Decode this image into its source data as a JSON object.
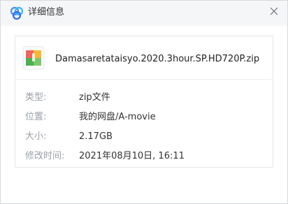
{
  "window": {
    "title": "详细信息",
    "app_logo_icon": "cloud-logo-icon",
    "close_icon": "close-icon"
  },
  "file": {
    "name": "Damasaretataisyo.2020.3hour.SP.HD720P.zip",
    "icon": "zip-file-icon"
  },
  "details": [
    {
      "label": "类型:",
      "value": "zip文件"
    },
    {
      "label": "位置:",
      "value": "我的网盘/A-movie"
    },
    {
      "label": "大小:",
      "value": "2.17GB"
    },
    {
      "label": "修改时间:",
      "value": "2021年08月10日, 16:11"
    }
  ],
  "colors": {
    "title_bar_bg": "#f5f6f8",
    "label_text": "#9aa0a8",
    "value_text": "#333333",
    "logo_blue": "#4a8df8"
  }
}
